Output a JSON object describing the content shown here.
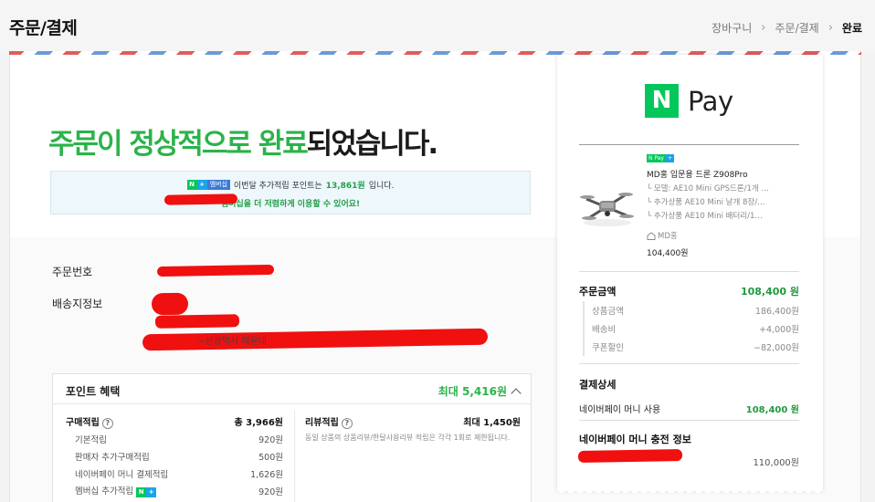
{
  "header": {
    "title": "주문/결제",
    "breadcrumb": [
      "장바구니",
      "주문/결제",
      "완료"
    ],
    "separator": "›"
  },
  "colors": {
    "accent": "#2bb34a",
    "naver": "#03c75a",
    "redact": "#f01010"
  },
  "complete": {
    "headline_green": "주문이 정상적으로 완료",
    "headline_rest": "되었습니다."
  },
  "notice": {
    "badge_n": "N",
    "badge_plus": "+",
    "badge_member": "멤버십",
    "line1_pre": "이번달 추가적립 포인트는",
    "line1_points": "13,861원",
    "line1_post": "입니다.",
    "line2": "멤버십을 더 저렴하게 이용할 수 있어요!"
  },
  "order": {
    "order_number_label": "주문번호",
    "shipping_label": "배송지정보",
    "address_fragment": "~산광역시 해운대"
  },
  "points": {
    "title": "포인트 혜택",
    "max": "최대 5,416원",
    "purchase": {
      "label": "구매적립",
      "total": "총 3,966원",
      "items": [
        {
          "label": "기본적립",
          "value": "920원"
        },
        {
          "label": "판매자 추가구매적립",
          "value": "500원"
        },
        {
          "label": "네이버페이 머니 결제적립",
          "value": "1,626원"
        },
        {
          "label": "멤버십 추가적립",
          "value": "920원"
        }
      ]
    },
    "review": {
      "label": "리뷰적립",
      "max": "최대 1,450원",
      "note": "동일 상품의 상품리뷰/한달사용리뷰 적립은 각각 1회로 제한됩니다."
    }
  },
  "receipt": {
    "logo_n": "N",
    "logo_pay": "Pay",
    "product": {
      "badge_n": "N Pay",
      "badge_plus": "+",
      "name": "MD홍 입문용 드론 Z908Pro",
      "options": [
        "└ 모델: AE10 Mini GPS드론/1개 …",
        "└ 추가상품 AE10 Mini 날개 8장/…",
        "└ 추가상품 AE10 Mini 배터리/1…"
      ],
      "seller": "MD홍",
      "price": "104,400원"
    },
    "order_amount": {
      "label": "주문금액",
      "value": "108,400 원",
      "items": [
        {
          "label": "상품금액",
          "value": "186,400원"
        },
        {
          "label": "배송비",
          "value": "+4,000원"
        },
        {
          "label": "쿠폰할인",
          "value": "−82,000원"
        }
      ]
    },
    "payment_detail": {
      "label": "결제상세",
      "method": "네이버페이 머니 사용",
      "value": "108,400 원"
    },
    "charge_info": {
      "label": "네이버페이 머니 충전 정보",
      "value": "110,000원"
    }
  }
}
